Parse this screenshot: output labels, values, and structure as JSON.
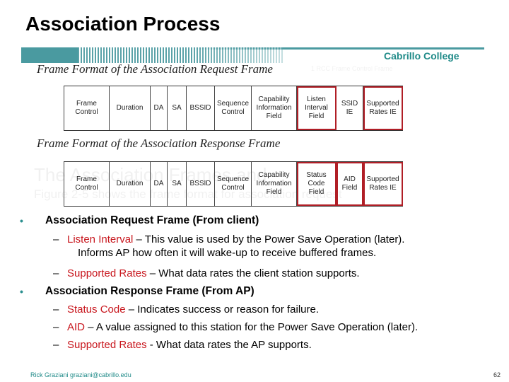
{
  "slide": {
    "title": "Association Process",
    "college": "Cabrillo College",
    "accent_color": "#4a9aa0",
    "highlight_color": "#b01e26",
    "emphasis_color": "#c8161d"
  },
  "ghost_text": [
    "1 RCC   Frame Control  Frame",
    "The Association Frames and",
    "Figure 2-5 shows the frame format for association request"
  ],
  "request_frame": {
    "caption": "Frame Format of the Association Request Frame",
    "fields": [
      {
        "label": "Frame\nControl",
        "highlighted": false
      },
      {
        "label": "Duration",
        "highlighted": false
      },
      {
        "label": "DA",
        "highlighted": false
      },
      {
        "label": "SA",
        "highlighted": false
      },
      {
        "label": "BSSID",
        "highlighted": false
      },
      {
        "label": "Sequence\nControl",
        "highlighted": false
      },
      {
        "label": "Capability\nInformation\nField",
        "highlighted": false
      },
      {
        "label": "Listen\nInterval\nField",
        "highlighted": true
      },
      {
        "label": "SSID\nIE",
        "highlighted": false
      },
      {
        "label": "Supported\nRates IE",
        "highlighted": true
      }
    ]
  },
  "response_frame": {
    "caption": "Frame Format of the Association Response Frame",
    "fields": [
      {
        "label": "Frame\nControl",
        "highlighted": false
      },
      {
        "label": "Duration",
        "highlighted": false
      },
      {
        "label": "DA",
        "highlighted": false
      },
      {
        "label": "SA",
        "highlighted": false
      },
      {
        "label": "BSSID",
        "highlighted": false
      },
      {
        "label": "Sequence\nControl",
        "highlighted": false
      },
      {
        "label": "Capability\nInformation\nField",
        "highlighted": false
      },
      {
        "label": "Status\nCode\nField",
        "highlighted": true
      },
      {
        "label": "AID\nField",
        "highlighted": true
      },
      {
        "label": "Supported\nRates IE",
        "highlighted": true
      }
    ]
  },
  "bullets": [
    {
      "text": "Association Request Frame (From client)",
      "sub": [
        {
          "term": "Listen Interval",
          "rest": " – This value is used by the Power Save Operation (later).",
          "cont": "Informs AP how often it will wake-up to receive buffered frames."
        },
        {
          "term": "Supported Rates",
          "rest": " – What data rates the client station supports."
        }
      ]
    },
    {
      "text": "Association Response Frame (From AP)",
      "sub": [
        {
          "term": "Status Code",
          "rest": " – Indicates success or reason for failure."
        },
        {
          "term": "AID",
          "rest": " – A value assigned to this station for the Power Save Operation (later)."
        },
        {
          "term": "Supported Rates",
          "rest": " - What data rates the AP supports."
        }
      ]
    }
  ],
  "bullet_symbol": "•",
  "dash_symbol": "–",
  "footer": {
    "author": "Rick Graziani  graziani@cabrillo.edu",
    "page": "62"
  }
}
